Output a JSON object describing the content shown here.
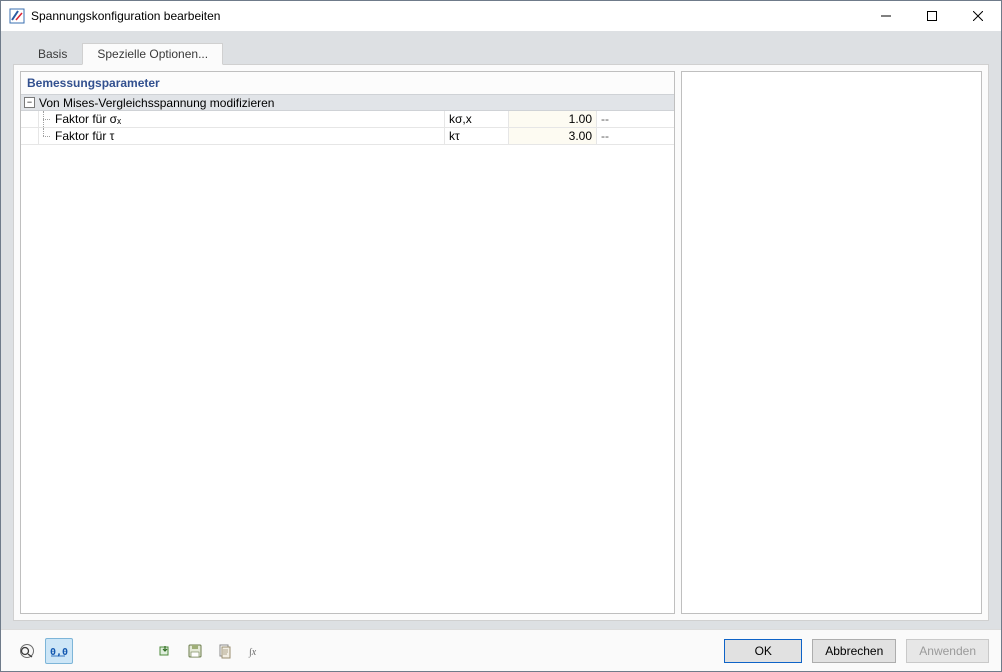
{
  "window": {
    "title": "Spannungskonfiguration bearbeiten"
  },
  "tabs": {
    "basis": "Basis",
    "special": "Spezielle Optionen...",
    "active_index": 1
  },
  "grid": {
    "title": "Bemessungsparameter",
    "group_label": "Von Mises-Vergleichsspannung modifizieren",
    "rows": [
      {
        "name": "Faktor für σₓ",
        "symbol": "kσ,x",
        "value": "1.00",
        "unit": "--"
      },
      {
        "name": "Faktor für τ",
        "symbol": "kτ",
        "value": "3.00",
        "unit": "--"
      }
    ]
  },
  "toolbar": {
    "help": "help-icon",
    "units": "units-icon",
    "import": "import-icon",
    "save_default": "save-default-icon",
    "clipboard": "clipboard-icon",
    "fx": "function-icon"
  },
  "buttons": {
    "ok": "OK",
    "cancel": "Abbrechen",
    "apply": "Anwenden"
  }
}
